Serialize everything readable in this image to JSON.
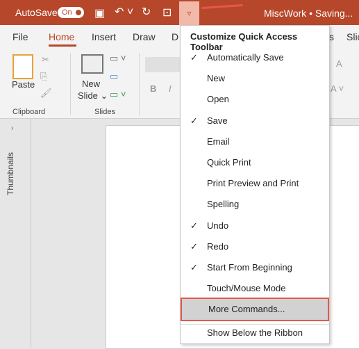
{
  "titlebar": {
    "autosave": "AutoSave",
    "toggle": "On",
    "doc": "MiscWork • Saving... ⌄",
    "accent": "#b7472a"
  },
  "tabs": [
    "File",
    "Home",
    "Insert",
    "Draw",
    "D",
    "s",
    "Slic"
  ],
  "ribbon": {
    "paste": "Paste",
    "new_slide": "New",
    "new_slide2": "Slide ⌄",
    "clipboard": "Clipboard",
    "slides": "Slides",
    "bold": "B",
    "italic": "I"
  },
  "thumbnails": "Thumbnails",
  "menu": {
    "title": "Customize Quick Access Toolbar",
    "items": [
      {
        "label": "Automatically Save",
        "checked": true
      },
      {
        "label": "New",
        "checked": false
      },
      {
        "label": "Open",
        "checked": false
      },
      {
        "label": "Save",
        "checked": true
      },
      {
        "label": "Email",
        "checked": false
      },
      {
        "label": "Quick Print",
        "checked": false
      },
      {
        "label": "Print Preview and Print",
        "checked": false
      },
      {
        "label": "Spelling",
        "checked": false
      },
      {
        "label": "Undo",
        "checked": true
      },
      {
        "label": "Redo",
        "checked": true
      },
      {
        "label": "Start From Beginning",
        "checked": true
      },
      {
        "label": "Touch/Mouse Mode",
        "checked": false
      },
      {
        "label": "More Commands...",
        "checked": false,
        "highlighted": true
      },
      {
        "label": "Show Below the Ribbon",
        "checked": false
      }
    ],
    "check": "✓"
  }
}
